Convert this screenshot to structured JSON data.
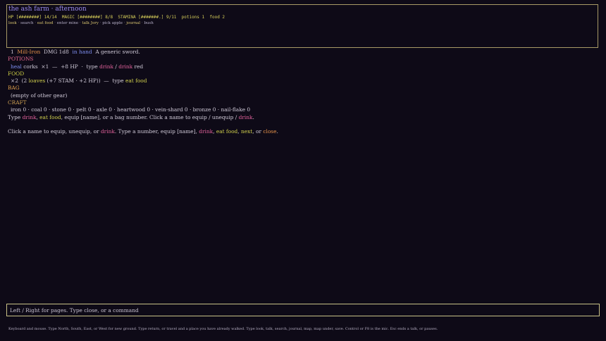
{
  "header": {
    "location": "the ash farm · afternoon",
    "status": "HP [########] 14/14  MAGIC [########] 8/8  STAMINA [#######.] 9/11  potions 1  food 2",
    "hints": [
      "look",
      "search",
      "eat food",
      "enter mine",
      "talk Jory",
      "pick apple",
      "journal",
      "bush"
    ],
    "hint_sep": " · "
  },
  "inventory": {
    "weapon": {
      "slot": "1",
      "name": "Mill-Iron",
      "damage": "DMG 1d8",
      "state": "in hand",
      "description": "A generic sword."
    },
    "potions": {
      "heading": "POTIONS",
      "name": "heal",
      "label": "corks",
      "count": "×1",
      "dash": "—",
      "effect": "+8 HP",
      "dot": "·",
      "type_word": "type",
      "cmd1": "drink",
      "slash": "/",
      "cmd2": "drink",
      "color_word": "red"
    },
    "food": {
      "heading": "FOOD",
      "count": "×2",
      "pre": "(2",
      "name": "loaves",
      "effect": "(+7 STAM · +2 HP))",
      "dash": "—",
      "type_word": "type",
      "cmd": "eat food"
    },
    "bag": {
      "heading": "BAG",
      "empty": "(empty of other gear)"
    },
    "craft": {
      "heading": "CRAFT",
      "materials": "iron 0 · coal 0 · stone 0 · pelt 0 · axle 0 · heartwood 0 · vein-shard 0 · bronze 0 · nail-flake 0"
    },
    "type_line": {
      "prefix": "Type",
      "drink": "drink",
      "comma1": ",",
      "eat_food": "eat food",
      "rest": ", equip [name], or a bag number. Click a name to equip / unequip /",
      "drink2": "drink",
      "end": "."
    },
    "click_line": {
      "prefix": "Click a name to equip, unequip, or",
      "drink": "drink",
      "mid": ". Type a number, equip [name],",
      "drink2": "drink",
      "comma": ",",
      "eat_food": "eat food",
      "comma2": ",",
      "next": "next",
      "or": ", or",
      "close": "close",
      "end": "."
    }
  },
  "command_input": {
    "value": "",
    "placeholder": "Left / Right for pages. Type close, or a command"
  },
  "footer": {
    "help": "Keyboard and mouse. Type North, South, East, or West for new ground. Type return, or travel and a place you have already walked. Type look, talk, search, journal, map, map under, save. Control or F8 is the mic. Esc ends a talk, or pauses."
  }
}
